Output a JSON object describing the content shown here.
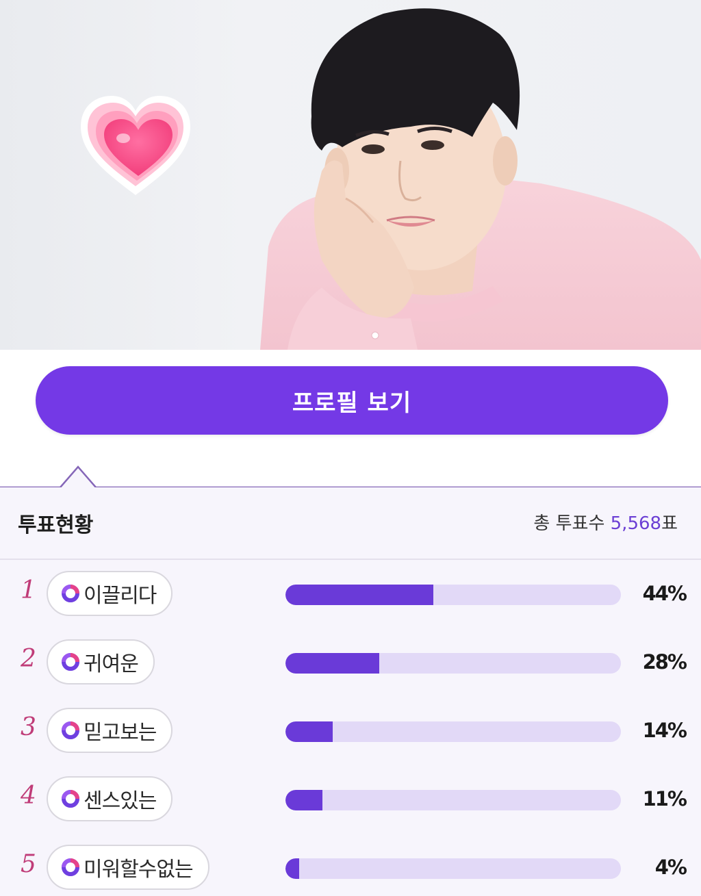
{
  "profile_button": {
    "label": "프로필 보기"
  },
  "vote": {
    "title": "투표현황",
    "total_prefix": "총 투표수 ",
    "total_count": "5,568",
    "total_suffix": "표",
    "items": [
      {
        "rank": "1",
        "label": "이끌리다",
        "percent_text": "44%",
        "percent": 44
      },
      {
        "rank": "2",
        "label": "귀여운",
        "percent_text": "28%",
        "percent": 28
      },
      {
        "rank": "3",
        "label": "믿고보는",
        "percent_text": "14%",
        "percent": 14
      },
      {
        "rank": "4",
        "label": "센스있는",
        "percent_text": "11%",
        "percent": 11
      },
      {
        "rank": "5",
        "label": "미워할수없는",
        "percent_text": "4%",
        "percent": 4
      }
    ]
  },
  "colors": {
    "accent": "#7439e6",
    "bar_fill": "#6a3ad8",
    "bar_track": "#e2d9f7",
    "rank": "#c03c78",
    "total_count": "#6b3fd4"
  },
  "icons": {
    "heart": "heart-sticker-icon",
    "chip": "ring-badge-icon"
  }
}
